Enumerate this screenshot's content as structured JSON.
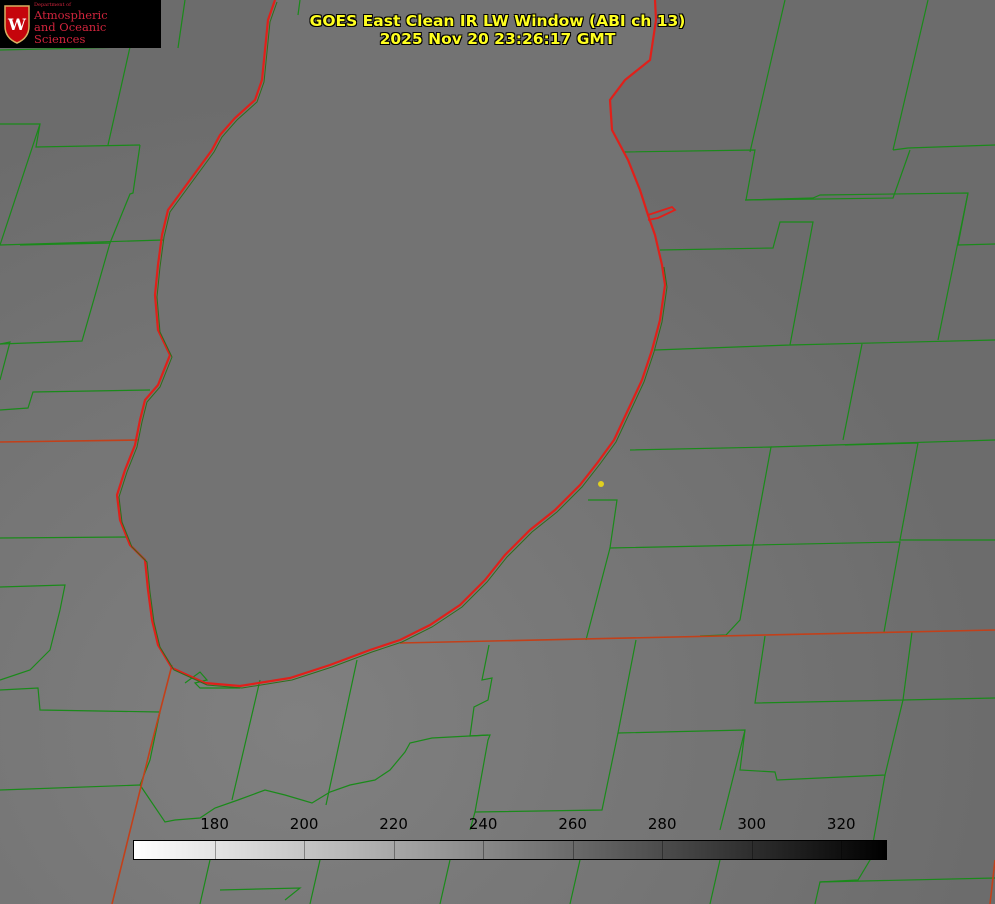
{
  "title": {
    "line1": "GOES East Clean IR LW Window (ABI ch 13)",
    "line2": "2025 Nov 20 23:26:17 GMT"
  },
  "logo": {
    "department": "Department of",
    "line1": "Atmospheric",
    "line2": "and Oceanic Sciences",
    "seal_letter": "W",
    "seal_color": "#c5050c"
  },
  "colorbar": {
    "ticks": [
      "180",
      "200",
      "220",
      "240",
      "260",
      "280",
      "300",
      "320"
    ],
    "range": [
      162,
      330
    ],
    "low_color": "#ffffff",
    "high_color": "#000000"
  },
  "colors": {
    "background": "#6f6f6f",
    "lake": "#747474",
    "county_lines": "#1a8a1a",
    "state_lines": "#c2401a",
    "shoreline": "#e0201a",
    "title": "#ffff20",
    "marker": "#e0d020"
  },
  "map": {
    "features": [
      "county-lines",
      "state-lines",
      "lake-shoreline",
      "station-marker"
    ]
  }
}
